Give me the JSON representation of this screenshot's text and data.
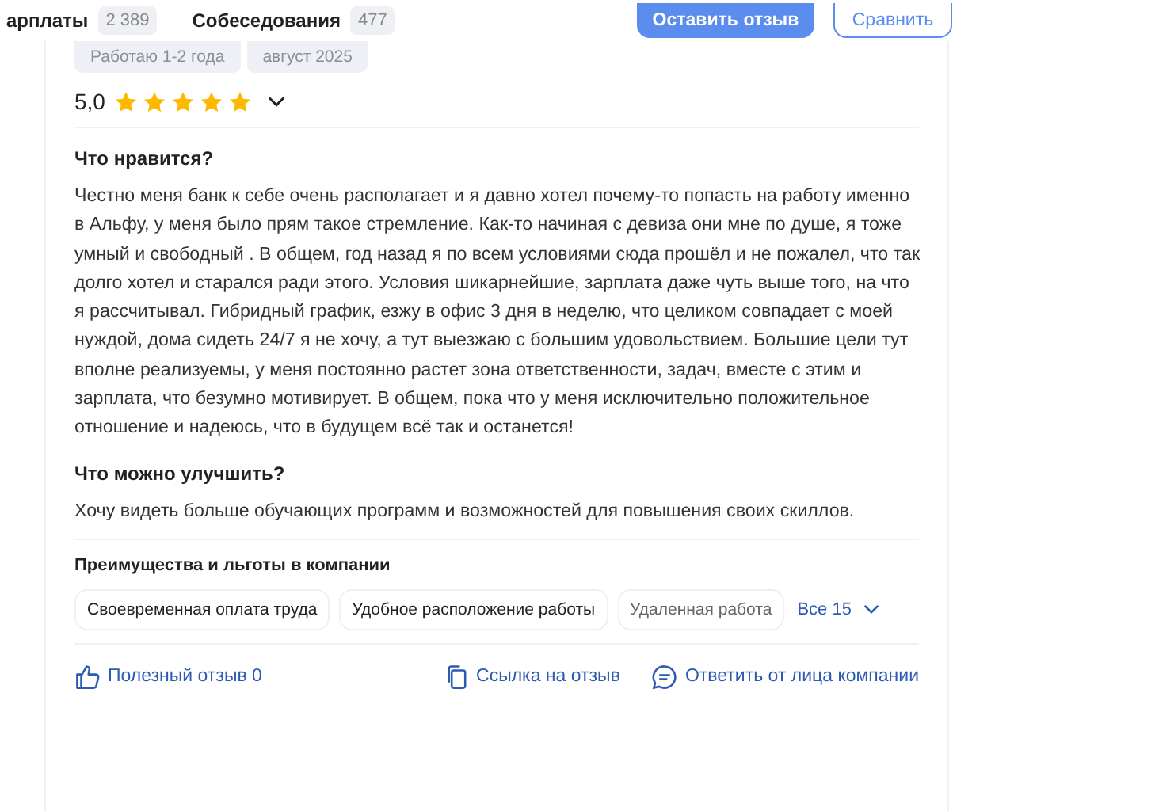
{
  "top_bar": {
    "tabs": [
      {
        "label": "арплаты",
        "count": "2 389",
        "selected": false
      },
      {
        "label": "Собеседования",
        "count": "477",
        "selected": false
      }
    ],
    "primary_button": "Оставить отзыв",
    "secondary_button": "Сравнить"
  },
  "review": {
    "tags": [
      "Работаю 1-2 года",
      "август 2025"
    ],
    "rating": "5,0",
    "stars": 5,
    "sections": [
      {
        "title": "Что нравится?",
        "text": "Честно меня банк к себе очень располагает и я давно хотел почему-то попасть на работу именно в Альфу, у меня было прям такое стремление. Как-то начиная с девиза они мне по душе, я тоже умный и свободный . В общем, год назад я по всем условиями сюда прошёл и не пожалел, что так долго хотел и старался ради этого. Условия шикарнейшие, зарплата даже чуть выше того, на что я рассчитывал. Гибридный график, езжу в офис 3 дня в неделю, что целиком совпадает с моей нуждой, дома сидеть 24/7 я не хочу, а тут выезжаю с большим удовольствием. Большие цели тут вполне реализуемы, у меня постоянно растет зона ответственности, задач, вместе с этим и зарплата, что безумно мотивирует. В общем, пока что у меня исключительно положительное отношение и надеюсь, что в будущем всё так и останется!"
      },
      {
        "title": "Что можно улучшить?",
        "text": "Хочу видеть больше обучающих программ и возможностей для повышения своих скиллов."
      }
    ],
    "benefits": {
      "title": "Преимущества и льготы в компании",
      "items": [
        "Своевременная оплата труда",
        "Удобное расположение работы",
        "Удаленная работа"
      ],
      "more": "Все 15"
    },
    "actions": [
      {
        "kind": "like",
        "label": "Полезный отзыв 0"
      },
      {
        "kind": "link",
        "label": "Ссылка на отзыв"
      },
      {
        "kind": "reply",
        "label": "Ответить от лица компании"
      }
    ]
  }
}
